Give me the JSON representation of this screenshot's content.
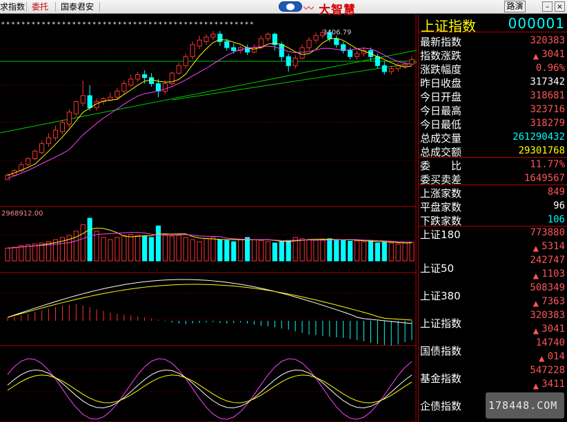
{
  "toolbar": {
    "items": [
      "求指数",
      "委托",
      "国泰君安"
    ],
    "logo_text": "大智慧",
    "route_label": "路演",
    "minimize": "–",
    "close": "×"
  },
  "panel": {
    "index_name": "上证指数",
    "index_code": "000001",
    "quotes": [
      {
        "label": "最新指数",
        "value": "320383",
        "color": "red"
      },
      {
        "label": "指数涨跌",
        "value": "3041",
        "color": "red",
        "arrow": "▲"
      },
      {
        "label": "涨跌幅度",
        "value": "0.96%",
        "color": "red"
      },
      {
        "label": "昨日收盘",
        "value": "317342",
        "color": "white"
      },
      {
        "label": "今日开盘",
        "value": "318681",
        "color": "red"
      },
      {
        "label": "今日最高",
        "value": "323716",
        "color": "red"
      },
      {
        "label": "今日最低",
        "value": "318279",
        "color": "red"
      },
      {
        "label": "总成交量",
        "value": "261290432",
        "color": "cyan"
      },
      {
        "label": "总成交额",
        "value": "29301768",
        "color": "yellow"
      }
    ],
    "ratio": [
      {
        "label": "委　　比",
        "value": "11.77%",
        "color": "red"
      },
      {
        "label": "委买卖差",
        "value": "1649567",
        "color": "red"
      }
    ],
    "breadth": [
      {
        "label": "上涨家数",
        "value": "849",
        "color": "red"
      },
      {
        "label": "平盘家数",
        "value": "96",
        "color": "white"
      },
      {
        "label": "下跌家数",
        "value": "106",
        "color": "cyan"
      }
    ],
    "indices": [
      {
        "label": "上证180",
        "value": "773880",
        "change": "5314"
      },
      {
        "label": "上证50",
        "value": "242747",
        "change": "1103"
      },
      {
        "label": "上证380",
        "value": "508349",
        "change": "7363"
      },
      {
        "label": "上证指数",
        "value": "320383",
        "change": "3041"
      },
      {
        "label": "国债指数",
        "value": "14740",
        "change": "014"
      },
      {
        "label": "基金指数",
        "value": "547228",
        "change": "3411"
      },
      {
        "label": "企债指数",
        "value": "",
        "change": ""
      }
    ]
  },
  "chart": {
    "price_header": "* * * * * * * * * * * * * * * * *  *  * * * * * * * * * * * * * * * * * * * * * * * * * * * * * * * *",
    "high_label": "3406.79",
    "volume_label": "2968912.00",
    "colors": {
      "up": "#ff3333",
      "down": "#00ffff",
      "ma5": "#ffffff",
      "ma10": "#ffff00",
      "ma20": "#ff44ff",
      "trend": "#00cc00",
      "grid": "#990000"
    }
  },
  "chart_data": {
    "type": "candlestick",
    "title": "上证指数",
    "max_price": 3406.79,
    "max_volume": 2968912.0,
    "candles": [
      {
        "o": 0.0,
        "c": 0.03,
        "h": 0.04,
        "l": 0.0
      },
      {
        "o": 0.03,
        "c": 0.06,
        "h": 0.07,
        "l": 0.02
      },
      {
        "o": 0.06,
        "c": 0.1,
        "h": 0.12,
        "l": 0.05
      },
      {
        "o": 0.1,
        "c": 0.14,
        "h": 0.15,
        "l": 0.09
      },
      {
        "o": 0.14,
        "c": 0.19,
        "h": 0.2,
        "l": 0.13
      },
      {
        "o": 0.18,
        "c": 0.24,
        "h": 0.26,
        "l": 0.17
      },
      {
        "o": 0.24,
        "c": 0.28,
        "h": 0.31,
        "l": 0.22
      },
      {
        "o": 0.28,
        "c": 0.33,
        "h": 0.36,
        "l": 0.26
      },
      {
        "o": 0.32,
        "c": 0.38,
        "h": 0.4,
        "l": 0.3
      },
      {
        "o": 0.37,
        "c": 0.45,
        "h": 0.47,
        "l": 0.35
      },
      {
        "o": 0.44,
        "c": 0.52,
        "h": 0.53,
        "l": 0.42
      },
      {
        "o": 0.51,
        "c": 0.56,
        "h": 0.66,
        "l": 0.49
      },
      {
        "o": 0.56,
        "c": 0.48,
        "h": 0.63,
        "l": 0.46
      },
      {
        "o": 0.48,
        "c": 0.52,
        "h": 0.54,
        "l": 0.46
      },
      {
        "o": 0.52,
        "c": 0.54,
        "h": 0.55,
        "l": 0.5
      },
      {
        "o": 0.53,
        "c": 0.55,
        "h": 0.58,
        "l": 0.52
      },
      {
        "o": 0.55,
        "c": 0.59,
        "h": 0.61,
        "l": 0.53
      },
      {
        "o": 0.59,
        "c": 0.64,
        "h": 0.66,
        "l": 0.57
      },
      {
        "o": 0.63,
        "c": 0.67,
        "h": 0.7,
        "l": 0.62
      },
      {
        "o": 0.67,
        "c": 0.7,
        "h": 0.72,
        "l": 0.65
      },
      {
        "o": 0.7,
        "c": 0.68,
        "h": 0.73,
        "l": 0.64
      },
      {
        "o": 0.68,
        "c": 0.64,
        "h": 0.71,
        "l": 0.62
      },
      {
        "o": 0.64,
        "c": 0.59,
        "h": 0.67,
        "l": 0.55
      },
      {
        "o": 0.59,
        "c": 0.64,
        "h": 0.66,
        "l": 0.57
      },
      {
        "o": 0.64,
        "c": 0.71,
        "h": 0.72,
        "l": 0.63
      },
      {
        "o": 0.71,
        "c": 0.76,
        "h": 0.78,
        "l": 0.7
      },
      {
        "o": 0.76,
        "c": 0.82,
        "h": 0.84,
        "l": 0.74
      },
      {
        "o": 0.82,
        "c": 0.9,
        "h": 0.92,
        "l": 0.8
      },
      {
        "o": 0.89,
        "c": 0.93,
        "h": 0.96,
        "l": 0.87
      },
      {
        "o": 0.92,
        "c": 0.95,
        "h": 0.97,
        "l": 0.9
      },
      {
        "o": 0.95,
        "c": 0.97,
        "h": 0.99,
        "l": 0.93
      },
      {
        "o": 0.97,
        "c": 0.92,
        "h": 0.99,
        "l": 0.89
      },
      {
        "o": 0.92,
        "c": 0.88,
        "h": 0.94,
        "l": 0.86
      },
      {
        "o": 0.88,
        "c": 0.86,
        "h": 0.91,
        "l": 0.84
      },
      {
        "o": 0.86,
        "c": 0.88,
        "h": 0.89,
        "l": 0.84
      },
      {
        "o": 0.88,
        "c": 0.85,
        "h": 0.9,
        "l": 0.83
      },
      {
        "o": 0.85,
        "c": 0.88,
        "h": 0.9,
        "l": 0.84
      },
      {
        "o": 0.88,
        "c": 0.94,
        "h": 0.96,
        "l": 0.87
      },
      {
        "o": 0.94,
        "c": 0.97,
        "h": 0.98,
        "l": 0.92
      },
      {
        "o": 0.97,
        "c": 0.9,
        "h": 0.98,
        "l": 0.86
      },
      {
        "o": 0.9,
        "c": 0.82,
        "h": 0.92,
        "l": 0.79
      },
      {
        "o": 0.82,
        "c": 0.76,
        "h": 0.84,
        "l": 0.72
      },
      {
        "o": 0.76,
        "c": 0.81,
        "h": 0.83,
        "l": 0.74
      },
      {
        "o": 0.81,
        "c": 0.88,
        "h": 0.9,
        "l": 0.8
      },
      {
        "o": 0.88,
        "c": 0.93,
        "h": 0.95,
        "l": 0.86
      },
      {
        "o": 0.93,
        "c": 0.96,
        "h": 0.98,
        "l": 0.91
      },
      {
        "o": 0.96,
        "c": 0.98,
        "h": 1.0,
        "l": 0.94
      },
      {
        "o": 0.98,
        "c": 0.94,
        "h": 1.0,
        "l": 0.92
      },
      {
        "o": 0.94,
        "c": 0.9,
        "h": 0.96,
        "l": 0.88
      },
      {
        "o": 0.9,
        "c": 0.86,
        "h": 0.92,
        "l": 0.84
      },
      {
        "o": 0.86,
        "c": 0.82,
        "h": 0.88,
        "l": 0.8
      },
      {
        "o": 0.82,
        "c": 0.84,
        "h": 0.86,
        "l": 0.8
      },
      {
        "o": 0.84,
        "c": 0.86,
        "h": 0.88,
        "l": 0.82
      },
      {
        "o": 0.86,
        "c": 0.82,
        "h": 0.88,
        "l": 0.79
      },
      {
        "o": 0.82,
        "c": 0.76,
        "h": 0.84,
        "l": 0.74
      },
      {
        "o": 0.76,
        "c": 0.72,
        "h": 0.79,
        "l": 0.7
      },
      {
        "o": 0.72,
        "c": 0.74,
        "h": 0.76,
        "l": 0.7
      },
      {
        "o": 0.74,
        "c": 0.76,
        "h": 0.78,
        "l": 0.72
      },
      {
        "o": 0.76,
        "c": 0.77,
        "h": 0.79,
        "l": 0.74
      },
      {
        "o": 0.77,
        "c": 0.8,
        "h": 0.82,
        "l": 0.76
      }
    ],
    "volume": [
      0.3,
      0.32,
      0.36,
      0.38,
      0.4,
      0.42,
      0.45,
      0.5,
      0.55,
      0.6,
      0.7,
      0.85,
      1.0,
      0.7,
      0.55,
      0.5,
      0.55,
      0.6,
      0.62,
      0.6,
      0.58,
      0.55,
      0.82,
      0.62,
      0.58,
      0.6,
      0.55,
      0.5,
      0.45,
      0.52,
      0.55,
      0.5,
      0.48,
      0.45,
      0.5,
      0.55,
      0.5,
      0.48,
      0.45,
      0.42,
      0.45,
      0.48,
      0.55,
      0.52,
      0.5,
      0.48,
      0.5,
      0.52,
      0.5,
      0.48,
      0.46,
      0.47,
      0.45,
      0.47,
      0.42,
      0.44,
      0.42,
      0.4,
      0.42,
      0.44
    ],
    "macd_hist": [
      0.1,
      0.14,
      0.2,
      0.26,
      0.32,
      0.38,
      0.44,
      0.5,
      0.55,
      0.58,
      0.6,
      0.55,
      0.5,
      0.42,
      0.36,
      0.3,
      0.26,
      0.22,
      0.2,
      0.16,
      0.12,
      0.08,
      0.04,
      -0.02,
      -0.06,
      -0.1,
      -0.12,
      -0.1,
      -0.08,
      -0.06,
      -0.05,
      -0.08,
      -0.1,
      -0.08,
      -0.06,
      -0.1,
      -0.14,
      -0.18,
      -0.2,
      -0.24,
      -0.28,
      -0.32,
      -0.38,
      -0.44,
      -0.5,
      -0.52,
      -0.55,
      -0.58,
      -0.6,
      -0.62,
      -0.66,
      -0.7,
      -0.74,
      -0.8,
      -0.85,
      -0.88,
      -0.9,
      -0.86,
      -0.78,
      -0.7
    ]
  }
}
